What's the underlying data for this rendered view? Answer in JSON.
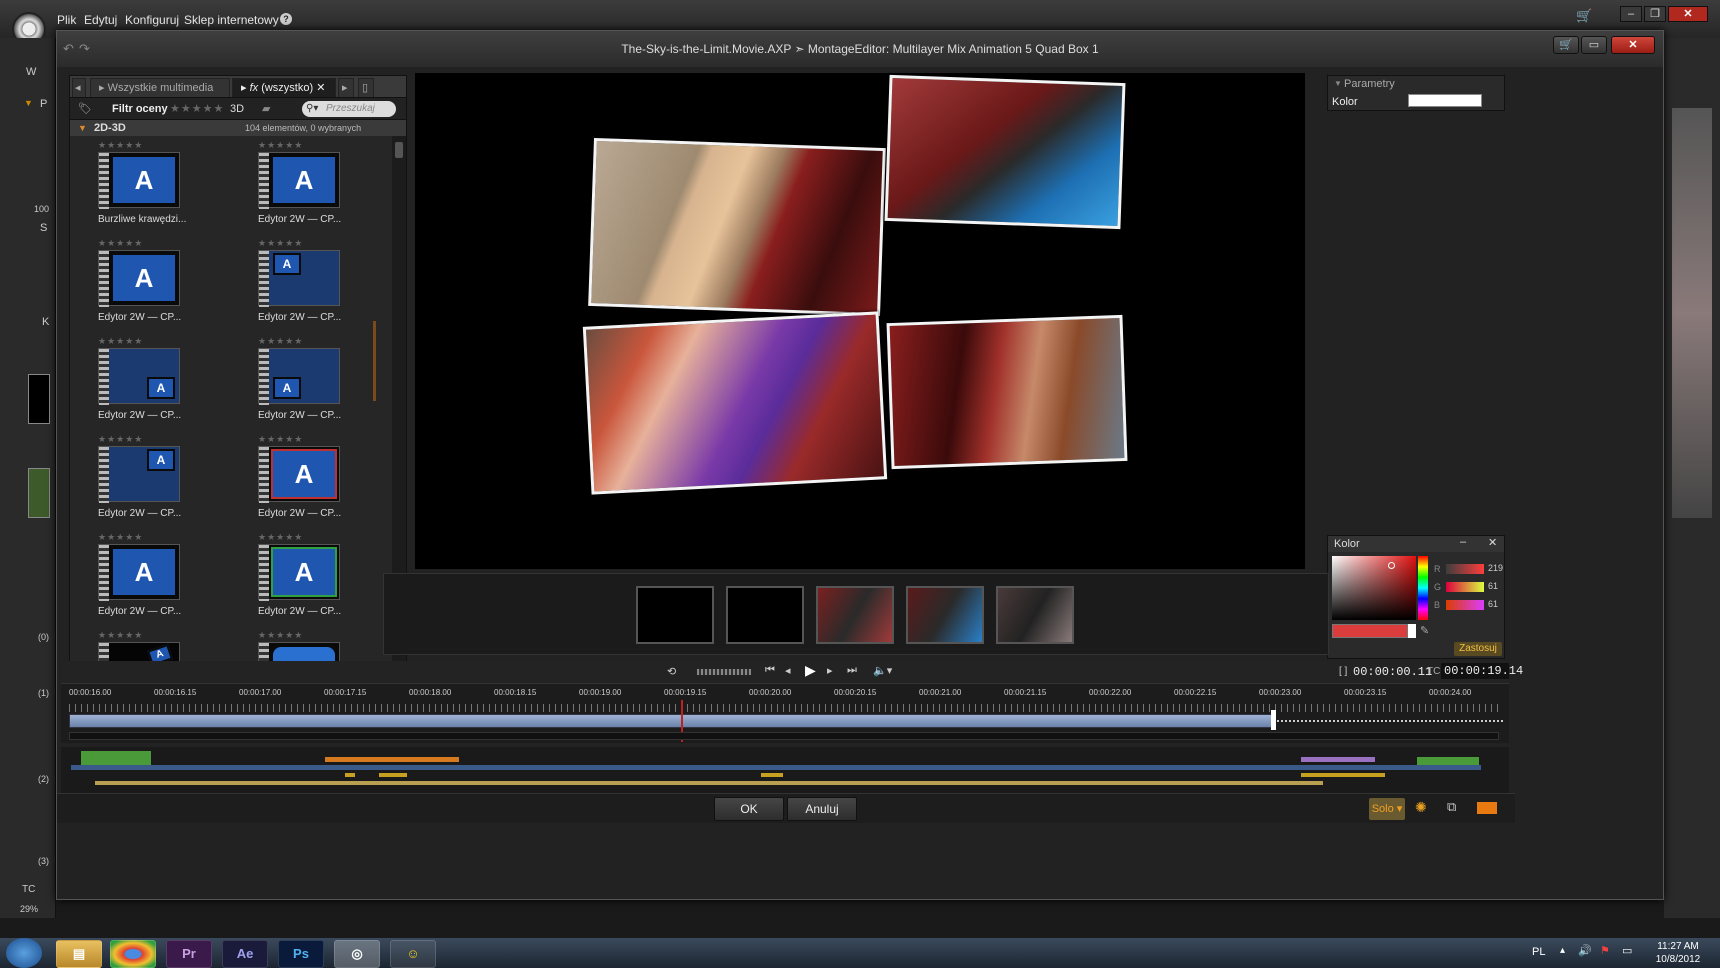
{
  "outer_menu": {
    "items": [
      "Plik",
      "Edytuj",
      "Konfiguruj",
      "Sklep internetowy"
    ]
  },
  "dialog": {
    "title": "The-Sky-is-the-Limit.Movie.AXP  ➣  MontageEditor: Multilayer Mix Animation  5 Quad Box 1"
  },
  "library": {
    "tab_media": "Wszystkie multimedia",
    "tab_fx": "(wszystko)",
    "filter_label": "Filtr oceny",
    "mode_3d": "3D",
    "search_placeholder": "Przeszukaj",
    "group_name": "2D-3D",
    "group_count": "104 elementów, 0 wybranych",
    "items": [
      {
        "label": "Burzliwe krawędzi...",
        "style": "full"
      },
      {
        "label": "Edytor 2W — CP...",
        "style": "full"
      },
      {
        "label": "Edytor 2W — CP...",
        "style": "full"
      },
      {
        "label": "Edytor 2W — CP...",
        "style": "tl"
      },
      {
        "label": "Edytor 2W — CP...",
        "style": "br"
      },
      {
        "label": "Edytor 2W — CP...",
        "style": "bl"
      },
      {
        "label": "Edytor 2W — CP...",
        "style": "tr"
      },
      {
        "label": "Edytor 2W — CP...",
        "style": "redborder"
      },
      {
        "label": "Edytor 2W — CP...",
        "style": "full"
      },
      {
        "label": "Edytor 2W — CP...",
        "style": "greenborder"
      },
      {
        "label": "",
        "style": "tilt"
      },
      {
        "label": "",
        "style": "round"
      }
    ]
  },
  "params": {
    "header": "Parametry",
    "color_label": "Kolor",
    "color_value": "#ffffff"
  },
  "color_panel": {
    "title": "Kolor",
    "r_label": "R",
    "r": "219",
    "g_label": "G",
    "g": "61",
    "b_label": "B",
    "b": "61",
    "apply": "Zastosuj",
    "swatch": "#db3d3d"
  },
  "transport": {
    "position": "00:00:00.11",
    "tc_label": "TC",
    "tc_value": "00:00:19.14"
  },
  "ruler": {
    "ticks": [
      "00:00:16.00",
      "00:00:16.15",
      "00:00:17.00",
      "00:00:17.15",
      "00:00:18.00",
      "00:00:18.15",
      "00:00:19.00",
      "00:00:19.15",
      "00:00:20.00",
      "00:00:20.15",
      "00:00:21.00",
      "00:00:21.15",
      "00:00:22.00",
      "00:00:22.15",
      "00:00:23.00",
      "00:00:23.15",
      "00:00:24.00"
    ]
  },
  "buttons": {
    "ok": "OK",
    "cancel": "Anuluj",
    "solo": "Solo"
  },
  "left_strip": {
    "pct": "100",
    "tc": "TC",
    "pct2": "29%",
    "k": "K",
    "w": "W",
    "p": "P",
    "s": "S",
    "tracks": [
      "(0)",
      "(1)",
      "(2)",
      "(3)"
    ]
  },
  "taskbar": {
    "apps": [
      "Pr",
      "Ae",
      "Ps"
    ],
    "lang": "PL",
    "time": "11:27 AM",
    "date": "10/8/2012"
  }
}
